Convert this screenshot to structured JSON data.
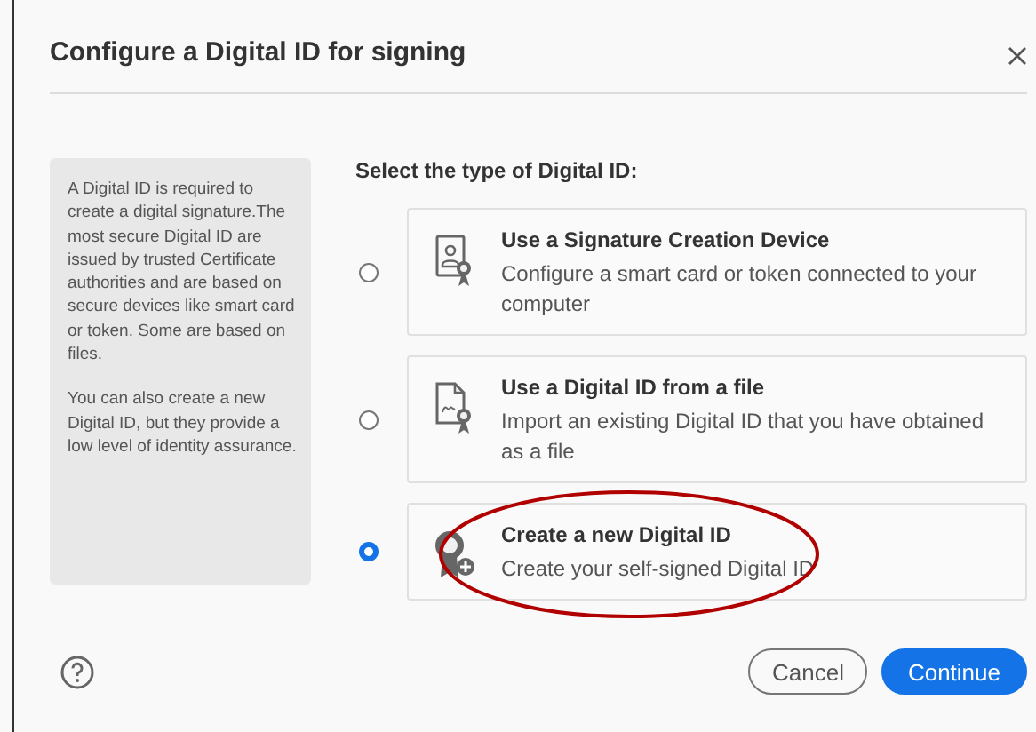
{
  "dialog": {
    "title": "Configure a Digital ID for signing",
    "info_panel": {
      "paragraphs": [
        "A Digital ID is required to create a digital signature.The most secure Digital ID are issued by trusted Certificate authorities and are based on secure devices like smart card or token. Some are based on files.",
        "You can also create a new Digital ID, but they provide a low level of identity assurance."
      ]
    },
    "prompt": "Select the type of Digital ID:",
    "options": [
      {
        "kind": "device",
        "title": "Use a Signature Creation Device",
        "description": "Configure a smart card or token connected to your computer",
        "selected": false,
        "highlighted": false
      },
      {
        "kind": "file",
        "title": "Use a Digital ID from a file",
        "description": "Import an existing Digital ID that you have obtained as a file",
        "selected": false,
        "highlighted": false
      },
      {
        "kind": "new",
        "title": "Create a new Digital ID",
        "description": "Create your self-signed Digital ID",
        "selected": true,
        "highlighted": true
      }
    ],
    "buttons": [
      {
        "kind": "secondary",
        "label": "Cancel"
      },
      {
        "kind": "primary",
        "label": "Continue"
      }
    ]
  }
}
